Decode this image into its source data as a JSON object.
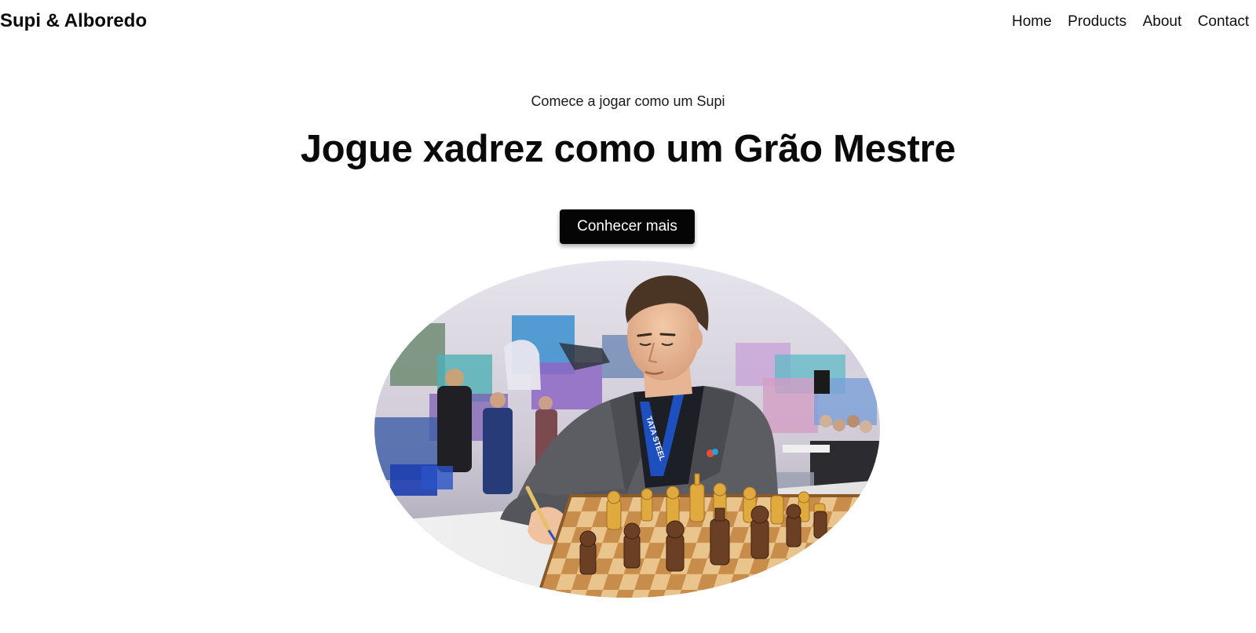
{
  "header": {
    "brand": "Supi & Alboredo",
    "nav": [
      {
        "label": "Home"
      },
      {
        "label": "Products"
      },
      {
        "label": "About"
      },
      {
        "label": "Contact"
      }
    ]
  },
  "hero": {
    "kicker": "Comece a jogar como um Supi",
    "title": "Jogue xadrez como um Grão Mestre",
    "cta_label": "Conhecer mais",
    "photo": {
      "lanyard_text": "TATA STEEL"
    }
  },
  "colors": {
    "text": "#0a0a0a",
    "button_bg": "#050505",
    "button_text": "#ffffff",
    "background": "#ffffff"
  }
}
